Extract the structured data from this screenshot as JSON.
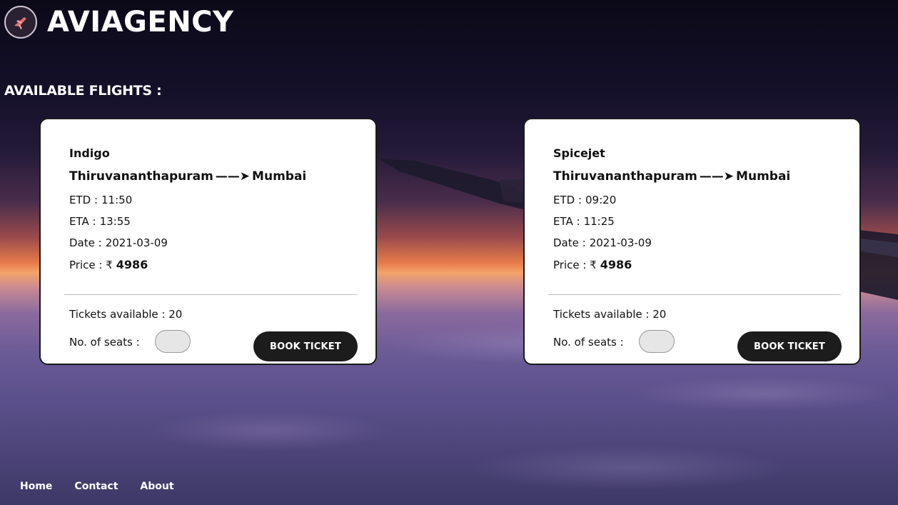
{
  "header": {
    "logo_icon": "plane-logo-icon",
    "brand": "AVIAGENCY"
  },
  "section_title": "AVAILABLE FLIGHTS :",
  "flights": [
    {
      "airline": "Indigo",
      "from": "Thiruvananthapuram",
      "to": "Mumbai",
      "arrow": "——➤",
      "etd_label": "ETD :",
      "etd": "11:50",
      "eta_label": "ETA :",
      "eta": "13:55",
      "date_label": "Date :",
      "date": "2021-03-09",
      "price_label": "Price : ₹",
      "price": "4986",
      "tickets_text": "Tickets available : 20",
      "seats_label": "No. of seats :",
      "seats_value": "",
      "book_label": "BOOK TICKET"
    },
    {
      "airline": "Spicejet",
      "from": "Thiruvananthapuram",
      "to": "Mumbai",
      "arrow": "——➤",
      "etd_label": "ETD :",
      "etd": "09:20",
      "eta_label": "ETA :",
      "eta": "11:25",
      "date_label": "Date :",
      "date": "2021-03-09",
      "price_label": "Price : ₹",
      "price": "4986",
      "tickets_text": "Tickets available : 20",
      "seats_label": "No. of seats :",
      "seats_value": "",
      "book_label": "BOOK TICKET"
    }
  ],
  "footer": {
    "links": [
      "Home",
      "Contact",
      "About"
    ]
  },
  "colors": {
    "card_bg": "#ffffff",
    "button_bg": "#1c1c1c",
    "text_light": "#ffffff"
  }
}
